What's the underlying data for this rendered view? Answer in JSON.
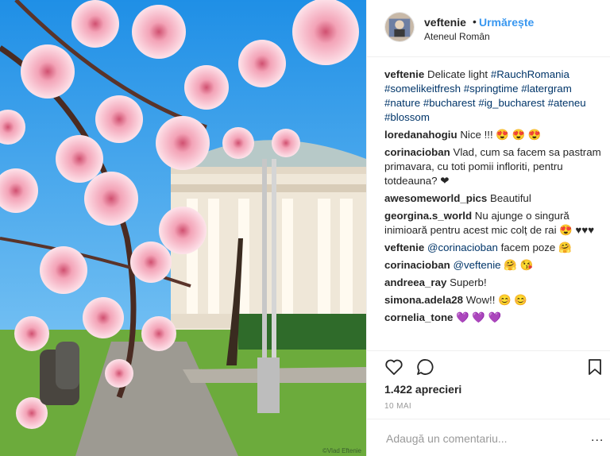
{
  "post": {
    "photo_alt": "Blossom tree in front of Ateneul Român",
    "watermark": "©Vlad Eftenie"
  },
  "header": {
    "username": "veftenie",
    "separator": "•",
    "follow_label": "Urmărește",
    "location": "Ateneul Român"
  },
  "caption": {
    "user": "veftenie",
    "text": "Delicate light",
    "tags": [
      "#RauchRomania",
      "#somelikeitfresh",
      "#springtime",
      "#latergram",
      "#nature",
      "#bucharest",
      "#ig_bucharest",
      "#ateneu",
      "#blossom"
    ]
  },
  "comments": [
    {
      "user": "loredanahogiu",
      "text": "Nice !!! 😍 😍 😍"
    },
    {
      "user": "corinacioban",
      "text": "Vlad, cum sa facem sa pastram primavara, cu toti pomii infloriti, pentru totdeauna? ❤"
    },
    {
      "user": "awesomeworld_pics",
      "text": "Beautiful"
    },
    {
      "user": "georgina.s_world",
      "text": "Nu ajunge o singură inimioară pentru acest mic colț de rai 😍 ♥♥♥"
    },
    {
      "user": "veftenie",
      "mention": "@corinacioban",
      "text": "facem poze 🤗"
    },
    {
      "user": "corinacioban",
      "mention": "@veftenie",
      "text": "🤗 😘"
    },
    {
      "user": "andreea_ray",
      "text": "Superb!"
    },
    {
      "user": "simona.adela28",
      "text": "Wow!! 😊 😊"
    },
    {
      "user": "cornelia_tone",
      "text": "💜 💜 💜"
    }
  ],
  "actions": {
    "icons": [
      "heart-icon",
      "comment-icon",
      "bookmark-icon"
    ],
    "likes": "1.422 aprecieri",
    "date": "10 MAI"
  },
  "add_comment": {
    "placeholder": "Adaugă un comentariu...",
    "more_label": "..."
  }
}
